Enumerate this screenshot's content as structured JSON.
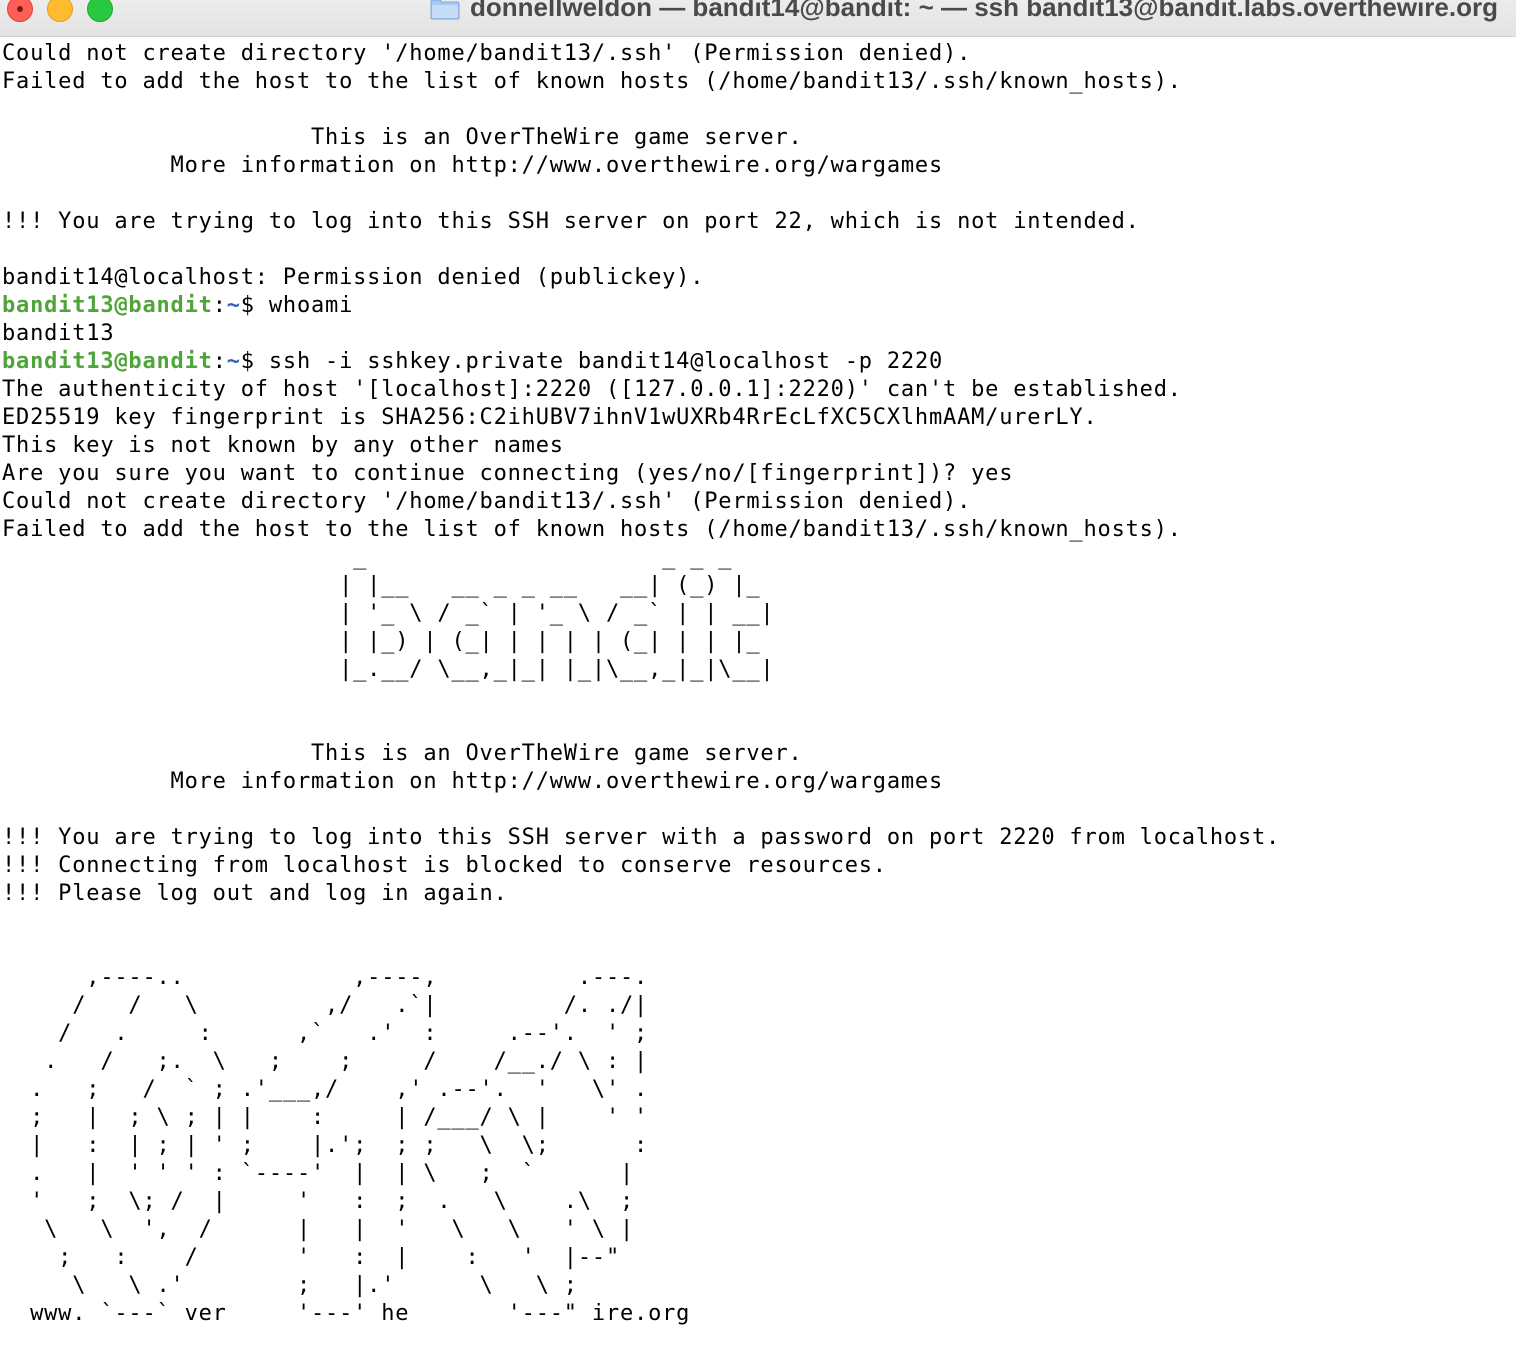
{
  "window": {
    "title": "donnellweldon — bandit14@bandit: ~ — ssh bandit13@bandit.labs.overthewire.org",
    "buttons": {
      "close": "close",
      "minimize": "minimize",
      "zoom": "zoom"
    }
  },
  "colors": {
    "prompt_user": "#4fa43a",
    "prompt_path": "#3b5fc0",
    "text": "#000000",
    "background": "#ffffff"
  },
  "terminal": {
    "lines": [
      {
        "text": "Could not create directory '/home/bandit13/.ssh' (Permission denied)."
      },
      {
        "text": "Failed to add the host to the list of known hosts (/home/bandit13/.ssh/known_hosts)."
      },
      {
        "text": ""
      },
      {
        "text": "                      This is an OverTheWire game server."
      },
      {
        "text": "            More information on http://www.overthewire.org/wargames"
      },
      {
        "text": ""
      },
      {
        "text": "!!! You are trying to log into this SSH server on port 22, which is not intended."
      },
      {
        "text": ""
      },
      {
        "text": "bandit14@localhost: Permission denied (publickey)."
      },
      {
        "prompt": {
          "user": "bandit13@bandit",
          "sep": ":",
          "path": "~",
          "symbol": "$ "
        },
        "text": "whoami"
      },
      {
        "text": "bandit13"
      },
      {
        "prompt": {
          "user": "bandit13@bandit",
          "sep": ":",
          "path": "~",
          "symbol": "$ "
        },
        "text": "ssh -i sshkey.private bandit14@localhost -p 2220"
      },
      {
        "text": "The authenticity of host '[localhost]:2220 ([127.0.0.1]:2220)' can't be established."
      },
      {
        "text": "ED25519 key fingerprint is SHA256:C2ihUBV7ihnV1wUXRb4RrEcLfXC5CXlhmAAM/urerLY."
      },
      {
        "text": "This key is not known by any other names"
      },
      {
        "text": "Are you sure you want to continue connecting (yes/no/[fingerprint])? yes"
      },
      {
        "text": "Could not create directory '/home/bandit13/.ssh' (Permission denied)."
      },
      {
        "text": "Failed to add the host to the list of known hosts (/home/bandit13/.ssh/known_hosts)."
      },
      {
        "text": "                         _                     _ _ _"
      },
      {
        "text": "                        | |__   __ _ _ __   __| (_) |_"
      },
      {
        "text": "                        | '_ \\ / _` | '_ \\ / _` | | __|"
      },
      {
        "text": "                        | |_) | (_| | | | | (_| | | |_"
      },
      {
        "text": "                        |_.__/ \\__,_|_| |_|\\__,_|_|\\__|"
      },
      {
        "text": ""
      },
      {
        "text": ""
      },
      {
        "text": "                      This is an OverTheWire game server."
      },
      {
        "text": "            More information on http://www.overthewire.org/wargames"
      },
      {
        "text": ""
      },
      {
        "text": "!!! You are trying to log into this SSH server with a password on port 2220 from localhost."
      },
      {
        "text": "!!! Connecting from localhost is blocked to conserve resources."
      },
      {
        "text": "!!! Please log out and log in again."
      },
      {
        "text": ""
      },
      {
        "text": ""
      },
      {
        "text": "      ,----..            ,----,          .---."
      },
      {
        "text": "     /   /   \\         ,/   .`|         /. ./|"
      },
      {
        "text": "    /   .     :      ,`   .'  :     .--'.  ' ;"
      },
      {
        "text": "   .   /   ;.  \\   ;    ;     /    /__./ \\ : |"
      },
      {
        "text": "  .   ;   /  ` ; .'___,/    ,' .--'.  '   \\' ."
      },
      {
        "text": "  ;   |  ; \\ ; | |    :     | /___/ \\ |    ' '"
      },
      {
        "text": "  |   :  | ; | ' ;    |.';  ; ;   \\  \\;      :"
      },
      {
        "text": "  .   |  ' ' ' : `----'  |  | \\   ;  `      |"
      },
      {
        "text": "  '   ;  \\; /  |     '   :  ;  .   \\    .\\  ;"
      },
      {
        "text": "   \\   \\  ',  /      |   |  '   \\   \\   ' \\ |"
      },
      {
        "text": "    ;   :    /       '   :  |    :   '  |--\""
      },
      {
        "text": "     \\   \\ .'        ;   |.'      \\   \\ ;"
      },
      {
        "text": "  www. `---` ver     '---' he       '---\" ire.org"
      }
    ]
  }
}
